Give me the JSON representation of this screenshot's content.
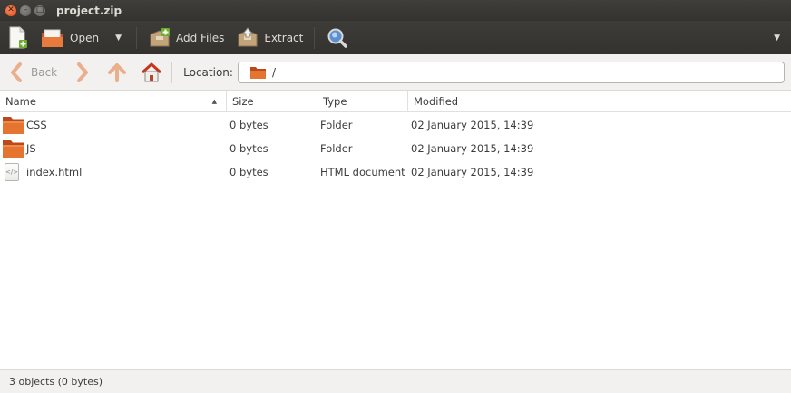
{
  "window": {
    "title": "project.zip"
  },
  "toolbar": {
    "open_label": "Open",
    "add_files_label": "Add Files",
    "extract_label": "Extract"
  },
  "nav": {
    "back_label": "Back",
    "location_label": "Location:",
    "location_value": "/"
  },
  "columns": {
    "name": "Name",
    "size": "Size",
    "type": "Type",
    "modified": "Modified"
  },
  "files": [
    {
      "name": "CSS",
      "size": "0 bytes",
      "type": "Folder",
      "modified": "02 January 2015, 14:39",
      "icon": "folder-icon"
    },
    {
      "name": "JS",
      "size": "0 bytes",
      "type": "Folder",
      "modified": "02 January 2015, 14:39",
      "icon": "folder-icon"
    },
    {
      "name": "index.html",
      "size": "0 bytes",
      "type": "HTML document",
      "modified": "02 January 2015, 14:39",
      "icon": "html-file-icon"
    }
  ],
  "status": {
    "text": "3 objects (0 bytes)"
  },
  "colors": {
    "titlebar": "#3c3b37",
    "close": "#e9541f",
    "folder": "#e06a2a",
    "accent_arrow": "#e8a170"
  }
}
